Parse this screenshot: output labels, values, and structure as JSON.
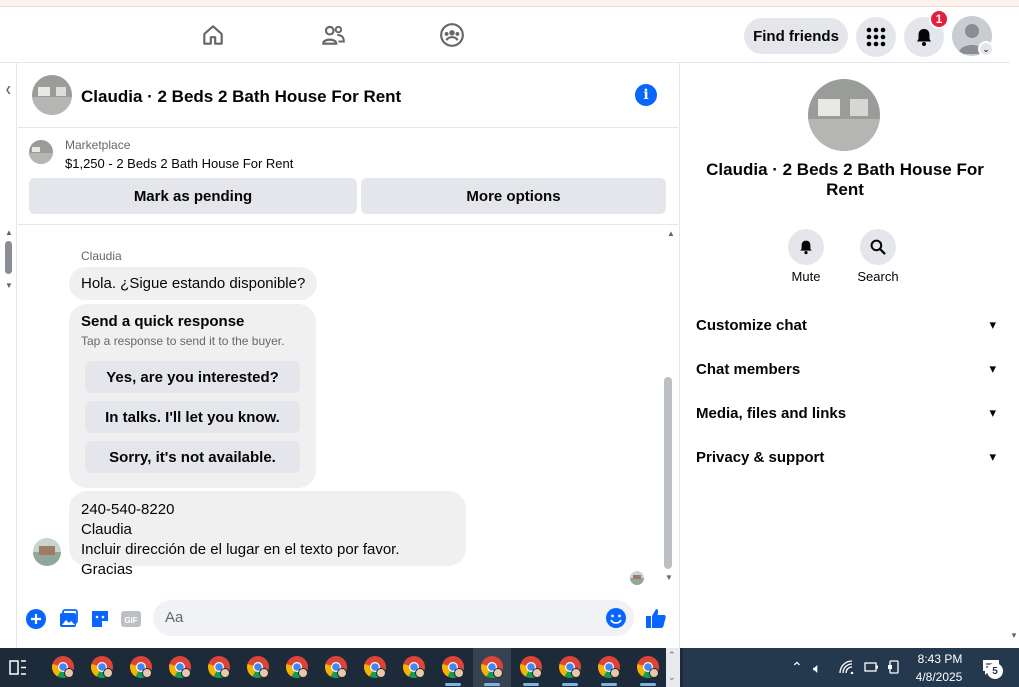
{
  "topnav": {
    "find_friends": "Find friends",
    "notification_count": "1",
    "icons": [
      "home-icon",
      "friends-icon",
      "groups-icon",
      "apps-grid-icon",
      "bell-icon"
    ]
  },
  "chat": {
    "title": "Claudia · 2 Beds 2 Bath House For Rent",
    "marketplace_label": "Marketplace",
    "listing": "$1,250 - 2 Beds 2 Bath House For Rent",
    "mark_pending": "Mark as pending",
    "more_options": "More options"
  },
  "messages": {
    "sender": "Claudia",
    "first": "Hola. ¿Sigue estando disponible?",
    "quick_title": "Send a quick response",
    "quick_sub": "Tap a response to send it to the buyer.",
    "quick_replies": [
      "Yes, are you interested?",
      "In talks. I'll let you know.",
      "Sorry, it's not available."
    ],
    "second_line1": "240-540-8220",
    "second_line2": "Claudia",
    "second_line3": "Incluir dirección de el lugar en el texto por favor. Gracias"
  },
  "composer": {
    "placeholder": "Aa"
  },
  "panel": {
    "title": "Claudia · 2 Beds 2 Bath House For Rent",
    "mute": "Mute",
    "search": "Search",
    "rows": [
      "Customize chat",
      "Chat members",
      "Media, files and links",
      "Privacy & support"
    ]
  },
  "taskbar": {
    "time": "8:43 PM",
    "date": "4/8/2025",
    "notifications": "5"
  },
  "colors": {
    "accent": "#0866ff",
    "badge": "#e41e3f",
    "taskbar": "#1c2a3a"
  }
}
